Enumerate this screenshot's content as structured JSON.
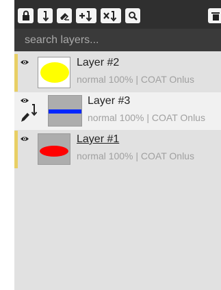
{
  "search": {
    "placeholder": "search layers..."
  },
  "toolbar": {
    "buttons": [
      {
        "name": "lock-button",
        "icon": "lock-icon"
      },
      {
        "name": "merge-down-button",
        "icon": "arrow-down-bracket-icon"
      },
      {
        "name": "eraser-button",
        "icon": "eraser-icon"
      },
      {
        "name": "add-layer-button",
        "icon": "plus-arrow-icon"
      },
      {
        "name": "delete-merge-button",
        "icon": "x-arrow-icon"
      },
      {
        "name": "search-button",
        "icon": "magnifier-icon"
      },
      {
        "name": "trash-button",
        "icon": "trash-icon"
      }
    ]
  },
  "layers": [
    {
      "name": "Layer #2",
      "meta": "normal 100% | COAT Onlus",
      "thumbnail": "yellow-ellipse",
      "selected": false
    },
    {
      "name": "Layer #3",
      "meta": "normal 100% | COAT Onlus",
      "thumbnail": "blue-line",
      "selected": true
    },
    {
      "name": "Layer #1",
      "meta": "normal 100% | COAT Onlus",
      "thumbnail": "red-ellipse",
      "selected": false
    }
  ],
  "colors": {
    "toolbar_bg": "#2f2f2f",
    "search_bg": "#3a3a3a",
    "panel_bg": "#e1e1e1",
    "selected_row": "#f1f1f1",
    "accent_bar": "#e8cf65",
    "yellow": "#ffff00",
    "blue": "#0026ff",
    "red": "#ff0000"
  }
}
